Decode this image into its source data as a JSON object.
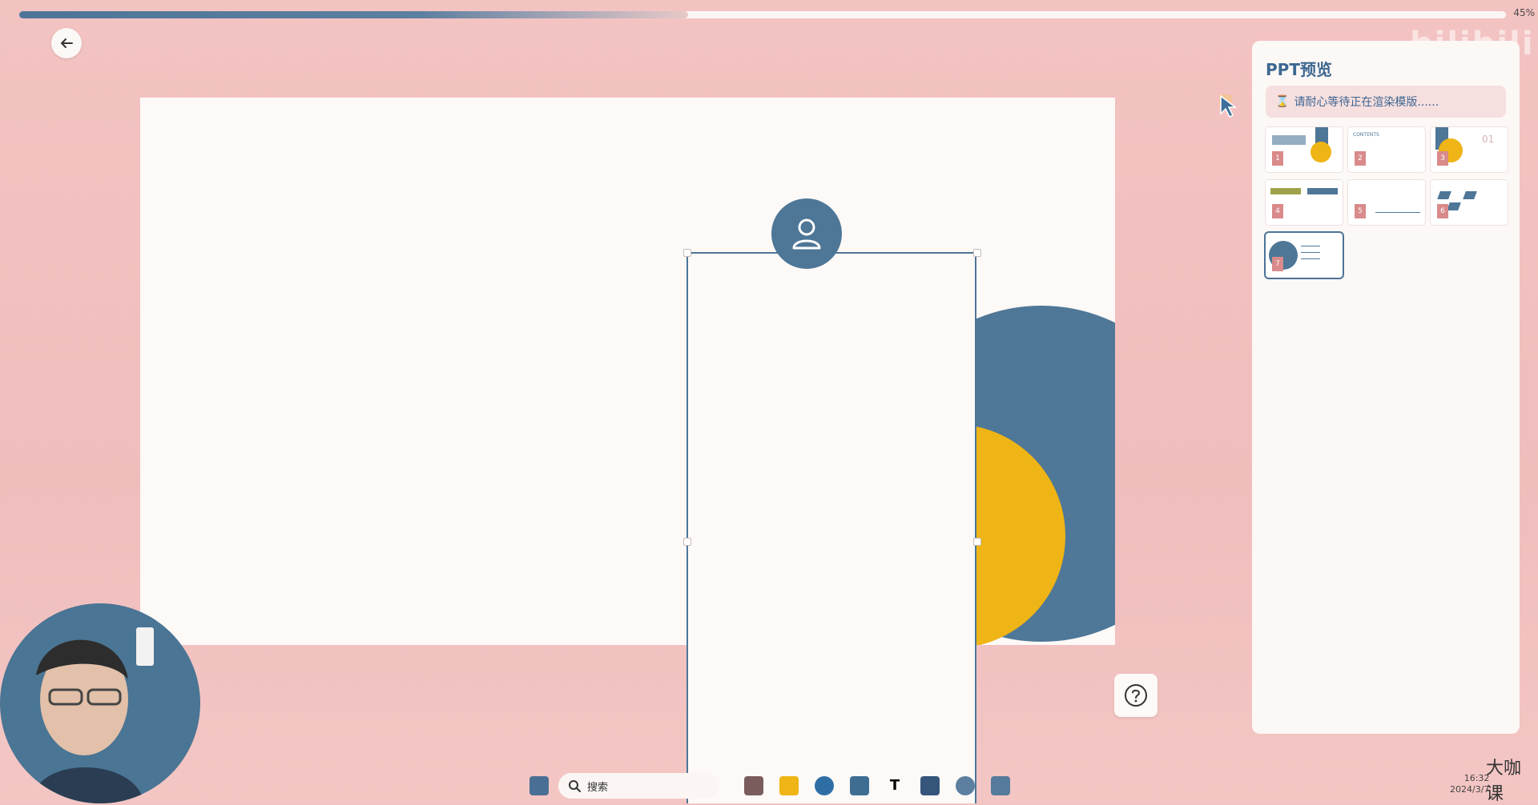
{
  "progress": {
    "value": 0.45,
    "label": "45%"
  },
  "icons": {
    "back": "arrow-left-icon",
    "user": "user-icon",
    "help": "question-icon",
    "hourglass": "hourglass-icon",
    "search": "search-icon"
  },
  "panel": {
    "title": "PPT预览",
    "notice": "请耐心等待正在渲染模版......",
    "thumbnails": [
      "1",
      "2",
      "3",
      "4",
      "5",
      "6",
      "7"
    ],
    "thumb3_text": "01",
    "thumb2_text": "CONTENTS"
  },
  "brand_watermark": "bilibili",
  "taskbar": {
    "search_placeholder": "搜索",
    "time": "16:32",
    "date": "2024/3/7"
  },
  "corner_watermark": "大咖课",
  "colors": {
    "background_pink": "#f0bdbd",
    "accent_blue": "#4e7697",
    "accent_yellow": "#efb415",
    "card_white": "#fcf9f7"
  }
}
